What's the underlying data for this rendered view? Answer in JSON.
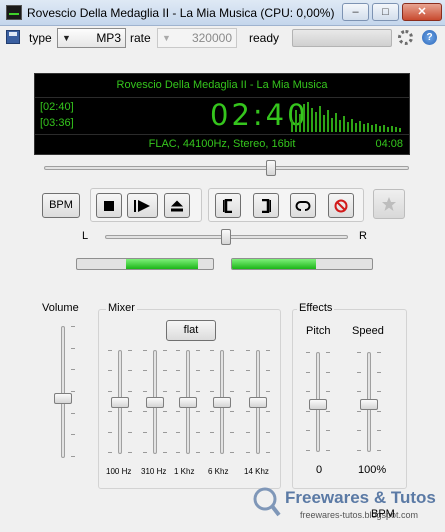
{
  "window": {
    "title": "Rovescio Della Medaglia II - La Mia Musica (CPU: 0,00%)",
    "min_label": "–",
    "max_label": "□",
    "close_label": "✕"
  },
  "toolbar": {
    "type_label": "type",
    "type_value": "MP3",
    "rate_label": "rate",
    "rate_value": "320000",
    "status": "ready",
    "help_label": "?"
  },
  "display": {
    "track_title": "Rovescio Della Medaglia II - La Mia Musica",
    "elapsed": "[02:40]",
    "total": "[03:36]",
    "time": "02:40",
    "format": "FLAC, 44100Hz, Stereo, 16bit",
    "remaining": "04:08",
    "color": "#35c51d"
  },
  "seek": {
    "position": 0.6
  },
  "transport": {
    "bpm_label": "BPM",
    "buttons": [
      "stop-icon",
      "play-icon",
      "eject-icon",
      "mark-in-icon",
      "mark-out-icon",
      "loop-icon",
      "cancel-icon",
      "star-icon"
    ]
  },
  "balance": {
    "left_label": "L",
    "right_label": "R",
    "position": 0.5
  },
  "levels": {
    "left": 0.62,
    "right": 0.59
  },
  "volume": {
    "label": "Volume",
    "level": 0.45
  },
  "mixer": {
    "label": "Mixer",
    "flat_label": "flat",
    "bands": [
      {
        "label": "100 Hz",
        "level": 0.5
      },
      {
        "label": "310 Hz",
        "level": 0.5
      },
      {
        "label": "1 Khz",
        "level": 0.5
      },
      {
        "label": "6 Khz",
        "level": 0.5
      },
      {
        "label": "14 Khz",
        "level": 0.5
      }
    ]
  },
  "effects": {
    "label": "Effects",
    "pitch_label": "Pitch",
    "pitch_value": "0",
    "speed_label": "Speed",
    "speed_value": "100%"
  },
  "footer": {
    "brand": "Freewares & Tutos",
    "url": "freewares-tutos.blogspot.com",
    "bpm_text": "BPM"
  }
}
